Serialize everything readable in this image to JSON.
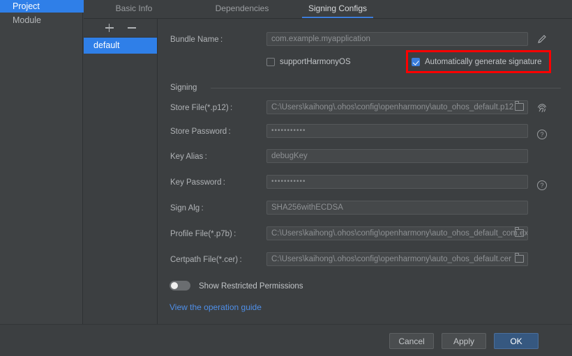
{
  "sidebar": {
    "items": [
      {
        "label": "Project",
        "selected": true
      },
      {
        "label": "Module",
        "selected": false
      }
    ]
  },
  "tabs": [
    {
      "label": "Basic Info",
      "active": false
    },
    {
      "label": "Dependencies",
      "active": false
    },
    {
      "label": "Signing Configs",
      "active": true
    }
  ],
  "config_list": {
    "add_button": "+",
    "remove_button": "−",
    "items": [
      {
        "label": "default",
        "selected": true
      }
    ]
  },
  "form": {
    "bundle_name": {
      "label": "Bundle Name :",
      "value": "com.example.myapplication",
      "edit_icon": "pencil-icon"
    },
    "support_harmonyos": {
      "label": "supportHarmonyOS",
      "checked": false
    },
    "auto_generate_signature": {
      "label": "Automatically generate signature",
      "checked": true,
      "highlight_color": "#ff0000"
    },
    "signing_group_title": "Signing",
    "store_file": {
      "label": "Store File(*.p12) :",
      "value": "C:\\Users\\kaihong\\.ohos\\config\\openharmony\\auto_ohos_default.p12",
      "browse_icon": "folder-icon",
      "side_icon": "fingerprint-icon"
    },
    "store_password": {
      "label": "Store Password :",
      "value": "•••••••••••",
      "side_icon": "help-icon"
    },
    "key_alias": {
      "label": "Key Alias :",
      "value": "debugKey"
    },
    "key_password": {
      "label": "Key Password :",
      "value": "•••••••••••",
      "side_icon": "help-icon"
    },
    "sign_alg": {
      "label": "Sign Alg :",
      "value": "SHA256withECDSA"
    },
    "profile_file": {
      "label": "Profile File(*.p7b) :",
      "value": "C:\\Users\\kaihong\\.ohos\\config\\openharmony\\auto_ohos_default_com.examp",
      "browse_icon": "folder-icon"
    },
    "certpath_file": {
      "label": "Certpath File(*.cer) :",
      "value": "C:\\Users\\kaihong\\.ohos\\config\\openharmony\\auto_ohos_default.cer",
      "browse_icon": "folder-icon"
    },
    "show_restricted_permissions": {
      "label": "Show Restricted Permissions",
      "enabled": false
    },
    "operation_guide_link": "View the operation guide"
  },
  "footer": {
    "cancel": "Cancel",
    "apply": "Apply",
    "ok": "OK"
  },
  "colors": {
    "accent_blue": "#2f7fe8",
    "tab_underline": "#3d7ddb",
    "panel_bg": "#3c3f41",
    "sidebar_bg": "#3f4244",
    "field_bg": "#45484a",
    "link_blue": "#4f8fe8",
    "primary_button": "#365880",
    "highlight_red": "#ff0000"
  }
}
